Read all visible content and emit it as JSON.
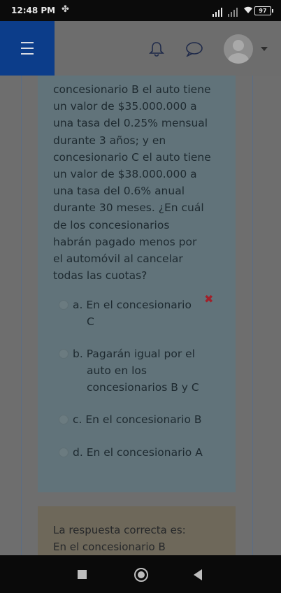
{
  "status": {
    "time": "12:48 PM",
    "battery": "97"
  },
  "appbar": {
    "menu_icon": "hamburger-icon",
    "notifications_icon": "bell-icon",
    "messages_icon": "chat-bubble-icon",
    "avatar_icon": "user-avatar-icon"
  },
  "question": {
    "lines": [
      "concesionario B el auto tiene",
      "un valor de $35.000.000 a",
      "una tasa del 0.25% mensual",
      "durante 3 años; y en",
      "concesionario C el auto tiene",
      "un valor de $38.000.000 a",
      "una tasa del 0.6% anual",
      "durante 30 meses. ¿En cuál",
      "de los concesionarios",
      "habrán pagado menos por",
      "el automóvil al cancelar",
      "todas las cuotas?"
    ],
    "options": [
      {
        "letter": "a.",
        "lines": [
          "En el concesionario",
          "C"
        ],
        "state": "selected-wrong"
      },
      {
        "letter": "b.",
        "lines": [
          "Pagarán igual por el",
          "auto en los",
          "concesionarios B y C"
        ],
        "state": ""
      },
      {
        "letter": "c.",
        "lines": [
          "En el concesionario B"
        ],
        "state": ""
      },
      {
        "letter": "d.",
        "lines": [
          "En el concesionario A"
        ],
        "state": ""
      }
    ],
    "wrong_mark": "✖"
  },
  "feedback": {
    "label": "La respuesta correcta es:",
    "answer": "En el concesionario B"
  },
  "colors": {
    "menu_bg": "#0c3d8a",
    "wrong": "#a0202a",
    "question_bg": "#61737a",
    "feedback_bg": "#6e685a"
  },
  "navbar": {
    "recent_icon": "square-icon",
    "home_icon": "circle-icon",
    "back_icon": "triangle-back-icon"
  }
}
